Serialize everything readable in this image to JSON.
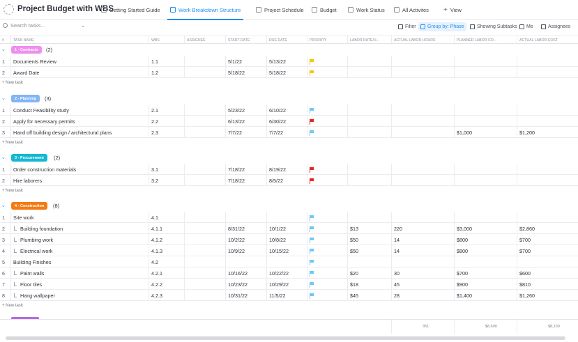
{
  "app": {
    "title": "Project Budget with WBS"
  },
  "tabs": [
    {
      "label": "Getting Started Guide",
      "icon": "doc-icon"
    },
    {
      "label": "Work Breakdown Structure",
      "icon": "list-icon",
      "active": true
    },
    {
      "label": "Project Schedule",
      "icon": "gantt-icon"
    },
    {
      "label": "Budget",
      "icon": "doc-icon"
    },
    {
      "label": "Work Status",
      "icon": "board-icon"
    },
    {
      "label": "All Activites",
      "icon": "list-icon"
    }
  ],
  "add_view": "View",
  "toolbar": {
    "search_placeholder": "Search tasks...",
    "filter": "Filter",
    "group_by": "Group by: Phase",
    "subtasks": "Showing Subtasks",
    "me": "Me",
    "assignees": "Assignees"
  },
  "columns": [
    "#",
    "TASK NAME",
    "WBS",
    "ASSIGNEE",
    "START DATE",
    "DUE DATE",
    "PRIORITY",
    "LABOR RATE/H...",
    "ACTUAL LABOR HOURS",
    "PLANNED LABOR CO...",
    "ACTUAL LABOR COST"
  ],
  "new_task_label": "+ New task",
  "colors": {
    "accent": "#1f8ff0",
    "flag_yellow": "#f6c600",
    "flag_blue": "#6fc8f5",
    "flag_red": "#e2272b"
  },
  "groups": [
    {
      "label": "1 - Contracts",
      "count": "(2)",
      "bg": "#ee8ff0",
      "fg": "#ffffff",
      "rows": [
        {
          "n": "1",
          "name": "Documents Review",
          "wbs": "1.1",
          "start": "5/1/22",
          "due": "5/13/22",
          "flag": "flag_yellow",
          "rate": "",
          "hours": "",
          "planned": "",
          "actual": "",
          "sub": false
        },
        {
          "n": "2",
          "name": "Award Date",
          "wbs": "1.2",
          "start": "5/18/22",
          "due": "5/18/22",
          "flag": "flag_yellow",
          "rate": "",
          "hours": "",
          "planned": "",
          "actual": "",
          "sub": false
        }
      ]
    },
    {
      "label": "2 - Planning",
      "count": "(3)",
      "bg": "#82b5f5",
      "fg": "#ffffff",
      "rows": [
        {
          "n": "1",
          "name": "Conduct Feasibility study",
          "wbs": "2.1",
          "start": "5/23/22",
          "due": "6/10/22",
          "flag": "flag_blue",
          "rate": "",
          "hours": "",
          "planned": "",
          "actual": "",
          "sub": false
        },
        {
          "n": "2",
          "name": "Apply for necessary permits",
          "wbs": "2.2",
          "start": "6/13/22",
          "due": "6/30/22",
          "flag": "flag_red",
          "rate": "",
          "hours": "",
          "planned": "",
          "actual": "",
          "sub": false
        },
        {
          "n": "3",
          "name": "Hand off building design / architectural plans",
          "wbs": "2.3",
          "start": "7/7/22",
          "due": "7/7/22",
          "flag": "flag_blue",
          "rate": "",
          "hours": "",
          "planned": "$1,000",
          "actual": "$1,200",
          "sub": false
        }
      ]
    },
    {
      "label": "3 - Procurement",
      "count": "(2)",
      "bg": "#14b8d3",
      "fg": "#ffffff",
      "rows": [
        {
          "n": "1",
          "name": "Order construction materials",
          "wbs": "3.1",
          "start": "7/18/22",
          "due": "8/19/22",
          "flag": "flag_red",
          "rate": "",
          "hours": "",
          "planned": "",
          "actual": "",
          "sub": false
        },
        {
          "n": "2",
          "name": "Hire laborers",
          "wbs": "3.2",
          "start": "7/18/22",
          "due": "8/5/22",
          "flag": "flag_red",
          "rate": "",
          "hours": "",
          "planned": "",
          "actual": "",
          "sub": false
        }
      ]
    },
    {
      "label": "4 - Construction",
      "count": "(8)",
      "bg": "#f57a13",
      "fg": "#ffffff",
      "rows": [
        {
          "n": "1",
          "name": "Site work",
          "wbs": "4.1",
          "start": "",
          "due": "",
          "flag": "flag_blue",
          "rate": "",
          "hours": "",
          "planned": "",
          "actual": "",
          "sub": false
        },
        {
          "n": "2",
          "name": "Building foundation",
          "wbs": "4.1.1",
          "start": "8/31/22",
          "due": "10/1/22",
          "flag": "flag_blue",
          "rate": "$13",
          "hours": "220",
          "planned": "$3,000",
          "actual": "$2,860",
          "sub": true
        },
        {
          "n": "3",
          "name": "Plumbing work",
          "wbs": "4.1.2",
          "start": "10/2/22",
          "due": "10/8/22",
          "flag": "flag_blue",
          "rate": "$50",
          "hours": "14",
          "planned": "$800",
          "actual": "$700",
          "sub": true
        },
        {
          "n": "4",
          "name": "Electrical work",
          "wbs": "4.1.3",
          "start": "10/9/22",
          "due": "10/15/22",
          "flag": "flag_blue",
          "rate": "$50",
          "hours": "14",
          "planned": "$800",
          "actual": "$700",
          "sub": true
        },
        {
          "n": "5",
          "name": "Building Finishes",
          "wbs": "4.2",
          "start": "",
          "due": "",
          "flag": "flag_blue",
          "rate": "",
          "hours": "",
          "planned": "",
          "actual": "",
          "sub": false
        },
        {
          "n": "6",
          "name": "Paint walls",
          "wbs": "4.2.1",
          "start": "10/16/22",
          "due": "10/22/22",
          "flag": "flag_blue",
          "rate": "$20",
          "hours": "30",
          "planned": "$700",
          "actual": "$600",
          "sub": true
        },
        {
          "n": "7",
          "name": "Floor tiles",
          "wbs": "4.2.2",
          "start": "10/23/22",
          "due": "10/29/22",
          "flag": "flag_blue",
          "rate": "$18",
          "hours": "45",
          "planned": "$900",
          "actual": "$810",
          "sub": true
        },
        {
          "n": "8",
          "name": "Hang wallpaper",
          "wbs": "4.2.3",
          "start": "10/31/22",
          "due": "11/5/22",
          "flag": "flag_blue",
          "rate": "$45",
          "hours": "28",
          "planned": "$1,400",
          "actual": "$1,260",
          "sub": true
        }
      ]
    }
  ],
  "totals": {
    "hours": "351",
    "planned": "$8,600",
    "actual": "$8,130"
  }
}
